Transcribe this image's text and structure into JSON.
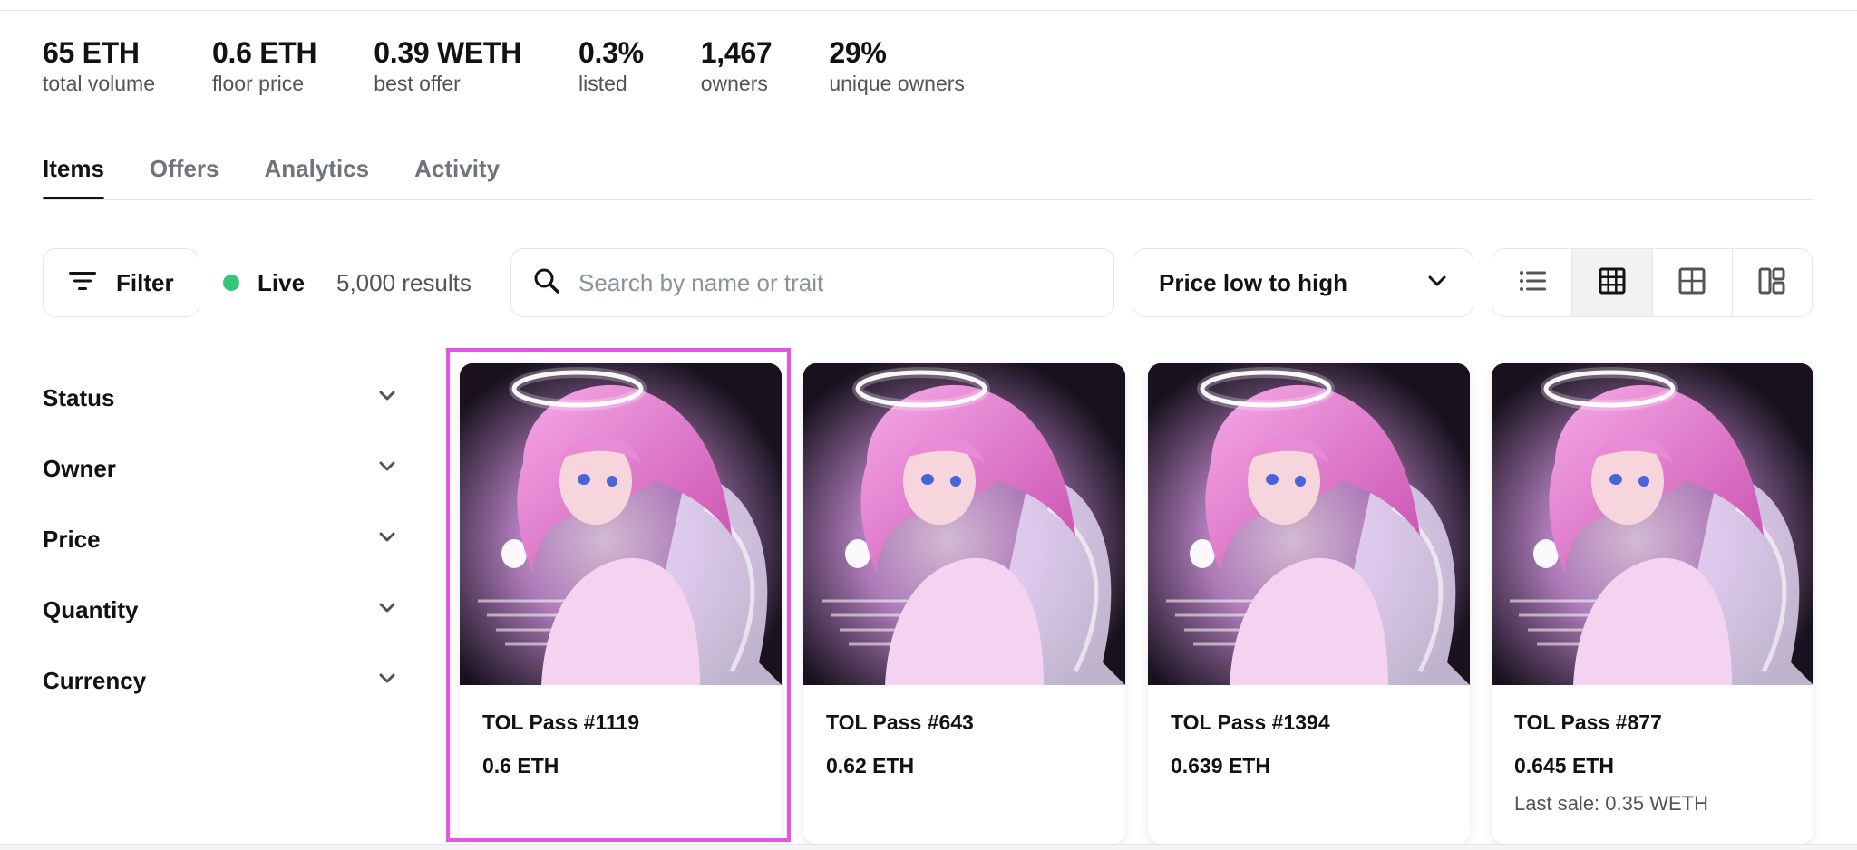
{
  "stats": [
    {
      "value": "65 ETH",
      "label": "total volume"
    },
    {
      "value": "0.6 ETH",
      "label": "floor price"
    },
    {
      "value": "0.39 WETH",
      "label": "best offer"
    },
    {
      "value": "0.3%",
      "label": "listed"
    },
    {
      "value": "1,467",
      "label": "owners"
    },
    {
      "value": "29%",
      "label": "unique owners"
    }
  ],
  "tabs": [
    {
      "label": "Items",
      "active": true
    },
    {
      "label": "Offers"
    },
    {
      "label": "Analytics"
    },
    {
      "label": "Activity"
    }
  ],
  "toolbar": {
    "filter_label": "Filter",
    "live_label": "Live",
    "live_color": "#34c77b",
    "results": "5,000 results",
    "search_placeholder": "Search by name or trait",
    "search_value": "",
    "sort_selected": "Price low to high",
    "view_modes": [
      "list-view-icon",
      "grid-small-icon",
      "grid-large-icon",
      "masonry-icon"
    ],
    "active_view": "grid-small-icon"
  },
  "sidebar": {
    "items": [
      {
        "label": "Status"
      },
      {
        "label": "Owner"
      },
      {
        "label": "Price"
      },
      {
        "label": "Quantity"
      },
      {
        "label": "Currency"
      }
    ]
  },
  "cards": [
    {
      "title": "TOL Pass #1119",
      "price": "0.6 ETH",
      "last_sale": "",
      "selected": true
    },
    {
      "title": "TOL Pass #643",
      "price": "0.62 ETH",
      "last_sale": ""
    },
    {
      "title": "TOL Pass #1394",
      "price": "0.639 ETH",
      "last_sale": ""
    },
    {
      "title": "TOL Pass #877",
      "price": "0.645 ETH",
      "last_sale": "Last sale: 0.35 WETH"
    }
  ],
  "colors": {
    "accent_highlight": "#e355e6",
    "text_primary": "#121212",
    "text_secondary": "#545454",
    "border": "#e5e8eb"
  }
}
